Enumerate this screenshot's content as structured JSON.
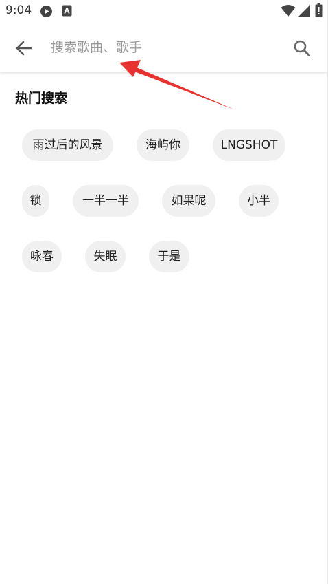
{
  "status_bar": {
    "time": "9:04",
    "icons": [
      "play-circle-icon",
      "a-box-icon",
      "wifi-icon",
      "signal-icon",
      "battery-icon"
    ]
  },
  "search": {
    "back_icon": "arrow-left-icon",
    "placeholder": "搜索歌曲、歌手",
    "value": "",
    "search_icon": "magnifier-icon"
  },
  "hot_search": {
    "title": "热门搜索",
    "tags": [
      "雨过后的风景",
      "海屿你",
      "LNGSHOT",
      "锁",
      "一半一半",
      "如果呢",
      "小半",
      "咏春",
      "失眠",
      "于是"
    ]
  },
  "colors": {
    "tag_background": "#f0f0f0",
    "annotation_arrow": "#e8322f",
    "placeholder": "#9a9a9a"
  }
}
